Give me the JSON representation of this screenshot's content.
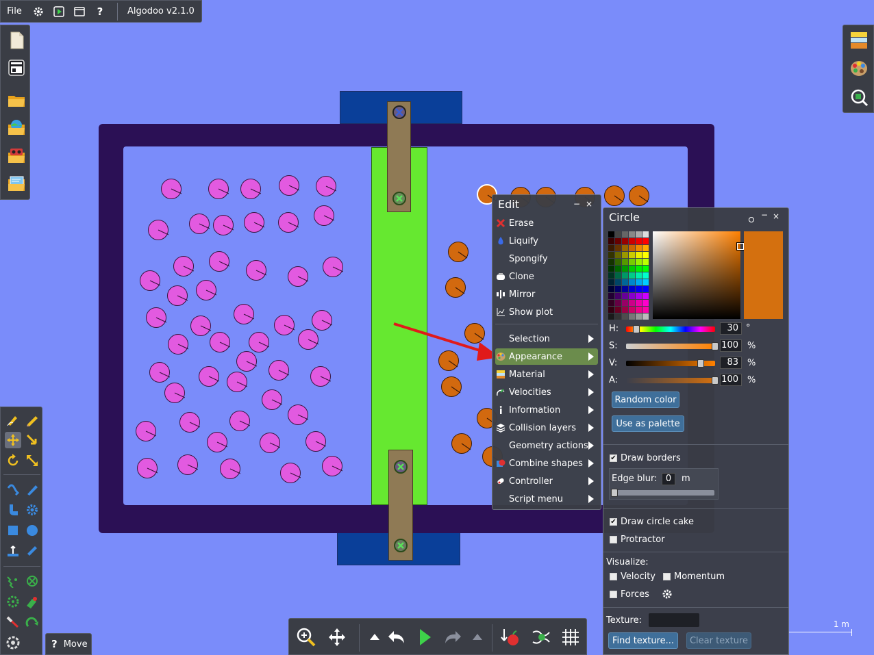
{
  "app": {
    "menu_file": "File",
    "version": "Algodoo v2.1.0"
  },
  "tool_status": {
    "help": "?",
    "label": "Move"
  },
  "edit_menu": {
    "title": "Edit",
    "items": [
      {
        "label": "Erase",
        "icon": "erase-icon"
      },
      {
        "label": "Liquify",
        "icon": "liquify-icon"
      },
      {
        "label": "Spongify",
        "icon": ""
      },
      {
        "label": "Clone",
        "icon": "clone-icon"
      },
      {
        "label": "Mirror",
        "icon": "mirror-icon"
      },
      {
        "label": "Show plot",
        "icon": "plot-icon"
      },
      {
        "label": "Selection",
        "submenu": true
      },
      {
        "label": "Appearance",
        "icon": "palette-icon",
        "submenu": true,
        "highlighted": true
      },
      {
        "label": "Material",
        "icon": "material-icon",
        "submenu": true
      },
      {
        "label": "Velocities",
        "icon": "velocities-icon",
        "submenu": true
      },
      {
        "label": "Information",
        "icon": "info-icon",
        "submenu": true
      },
      {
        "label": "Collision layers",
        "icon": "layers-icon",
        "submenu": true
      },
      {
        "label": "Geometry actions",
        "submenu": true
      },
      {
        "label": "Combine shapes",
        "icon": "combine-icon",
        "submenu": true
      },
      {
        "label": "Controller",
        "icon": "controller-icon",
        "submenu": true
      },
      {
        "label": "Script menu",
        "submenu": true
      }
    ]
  },
  "circle_panel": {
    "title": "Circle",
    "current_color": "#d4700f",
    "h": {
      "label": "H:",
      "value": "30",
      "unit": "°",
      "fraction": 0.083
    },
    "s": {
      "label": "S:",
      "value": "100",
      "unit": "%",
      "fraction": 1.0
    },
    "v": {
      "label": "V:",
      "value": "83",
      "unit": "%",
      "fraction": 0.83
    },
    "a": {
      "label": "A:",
      "value": "100",
      "unit": "%",
      "fraction": 1.0
    },
    "random_color": "Random color",
    "use_as_palette": "Use as palette",
    "draw_borders": {
      "label": "Draw borders",
      "checked": true
    },
    "edge_blur": {
      "label": "Edge blur:",
      "value": "0",
      "unit": "m"
    },
    "draw_circle_cake": {
      "label": "Draw circle cake",
      "checked": true
    },
    "protractor": {
      "label": "Protractor",
      "checked": false
    },
    "visualize": "Visualize:",
    "velocity": {
      "label": "Velocity",
      "checked": false
    },
    "momentum": {
      "label": "Momentum",
      "checked": false
    },
    "forces": {
      "label": "Forces",
      "checked": false
    },
    "texture": "Texture:",
    "find_texture": "Find texture...",
    "clear_texture": "Clear texture"
  },
  "scale": {
    "label": "1 m"
  },
  "colors": {
    "background": "#7a8cfa",
    "container": "#2b1055",
    "fluid_area": "#7a8cfa",
    "divider": "#66e830",
    "blocks": "#0a3f99",
    "pink_balls": "#e25ae0",
    "orange_balls": "#d2690f",
    "hinge_bar": "#8f7a55"
  }
}
